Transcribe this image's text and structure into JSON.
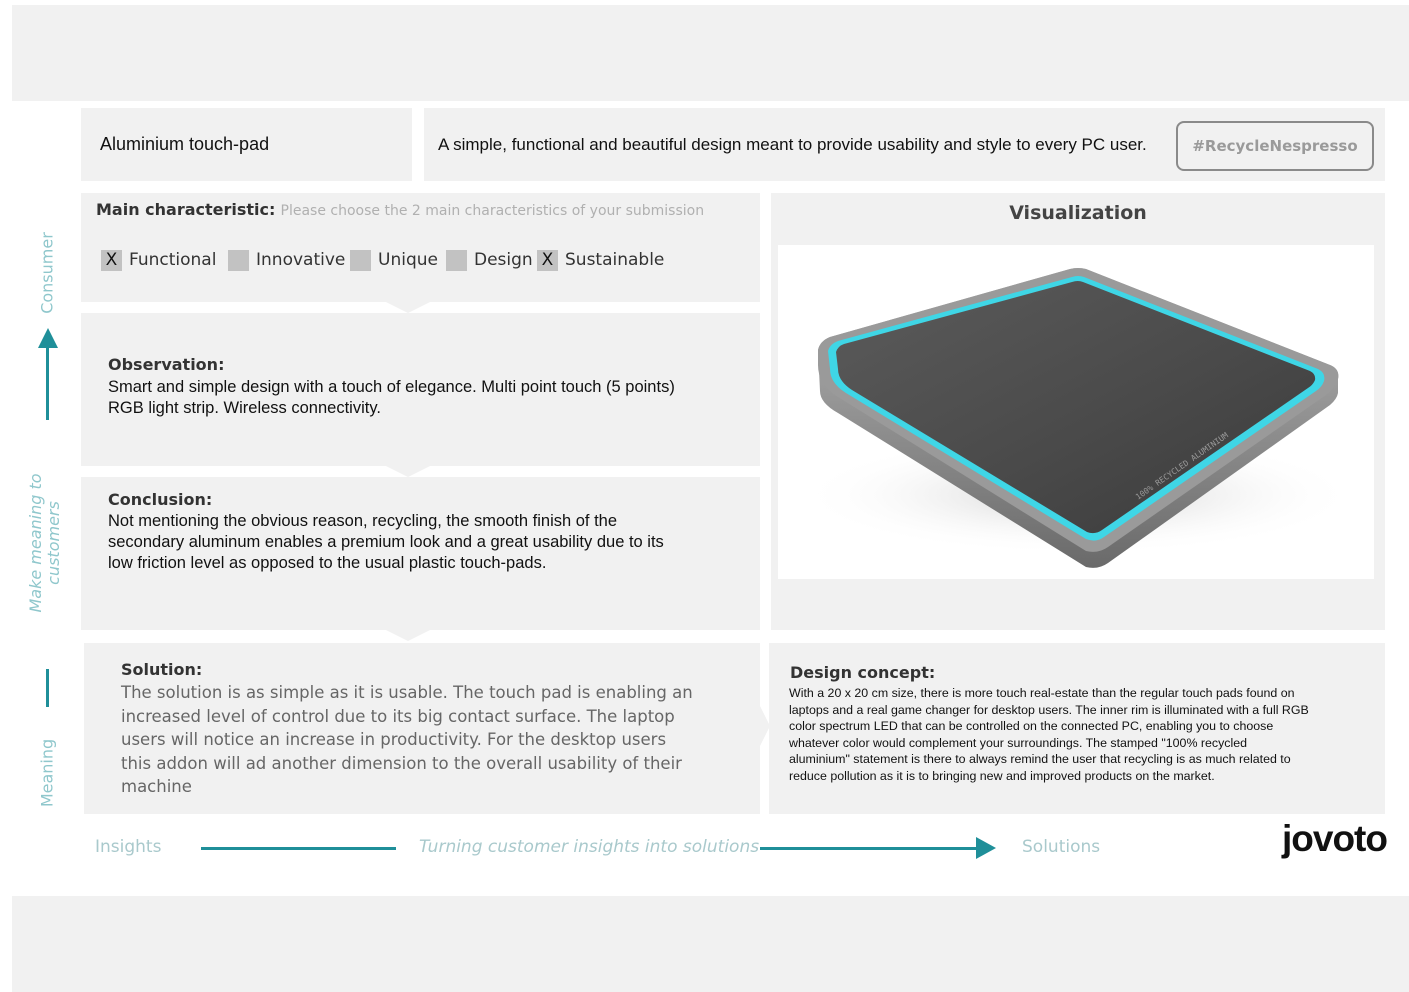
{
  "header": {
    "title": "Aluminium touch-pad",
    "description": "A simple, functional and beautiful design meant to provide usability and style to every PC user.",
    "hashtag": "#RecycleNespresso"
  },
  "characteristics": {
    "label": "Main characteristic:",
    "hint": "Please choose the 2 main characteristics of your submission",
    "items": [
      {
        "label": "Functional",
        "mark": "X",
        "checked": true
      },
      {
        "label": "Innovative",
        "mark": "",
        "checked": false
      },
      {
        "label": "Unique",
        "mark": "",
        "checked": false
      },
      {
        "label": "Design",
        "mark": "",
        "checked": false
      },
      {
        "label": "Sustainable",
        "mark": "X",
        "checked": true
      }
    ]
  },
  "observation": {
    "heading": "Observation:",
    "lines": [
      "Smart and simple design with a touch of elegance. Multi point touch (5 points)",
      "RGB light strip. Wireless connectivity."
    ]
  },
  "conclusion": {
    "heading": "Conclusion:",
    "lines": [
      "Not mentioning the obvious reason, recycling, the smooth finish of the",
      "secondary aluminum enables a premium look and a great usability due to its",
      "low friction level as opposed to the usual plastic touch-pads."
    ]
  },
  "solution": {
    "heading": "Solution:",
    "lines": [
      "The solution is as simple as it is usable. The touch pad  is enabling an",
      "increased level of control due to its big contact surface.  The laptop",
      "users will notice an increase in productivity. For the desktop users",
      "this addon will ad another dimension to the overall usability of their",
      "machine"
    ]
  },
  "visualization": {
    "heading": "Visualization",
    "engraving": "100% RECYCLED ALUMINIUM",
    "led_color": "#3fd6e6"
  },
  "design_concept": {
    "heading": "Design concept:",
    "lines": [
      "With a 20 x 20 cm size, there is more touch real-estate than the regular touch pads found on",
      "laptops and a real game changer for desktop users. The inner rim is illuminated with a full RGB",
      "color spectrum LED that can be controlled on the connected PC, enabling you to choose",
      "whatever color would complement your surroundings.  The stamped \"100% recycled",
      "aluminium\" statement is there to always remind the user that recycling is as much related to",
      "reduce pollution as it is to bringing new and improved products on the market."
    ]
  },
  "side_labels": {
    "consumer": "Consumer",
    "make_meaning_1": "Make meaning to",
    "make_meaning_2": "customers",
    "meaning": "Meaning"
  },
  "bottom": {
    "insights": "Insights",
    "tagline": "Turning customer insights into solutions",
    "solutions": "Solutions",
    "logo": "jovoto"
  },
  "colors": {
    "accent": "#1f8f99",
    "panel": "#f1f1f1",
    "side_text": "#8fc7cc"
  }
}
